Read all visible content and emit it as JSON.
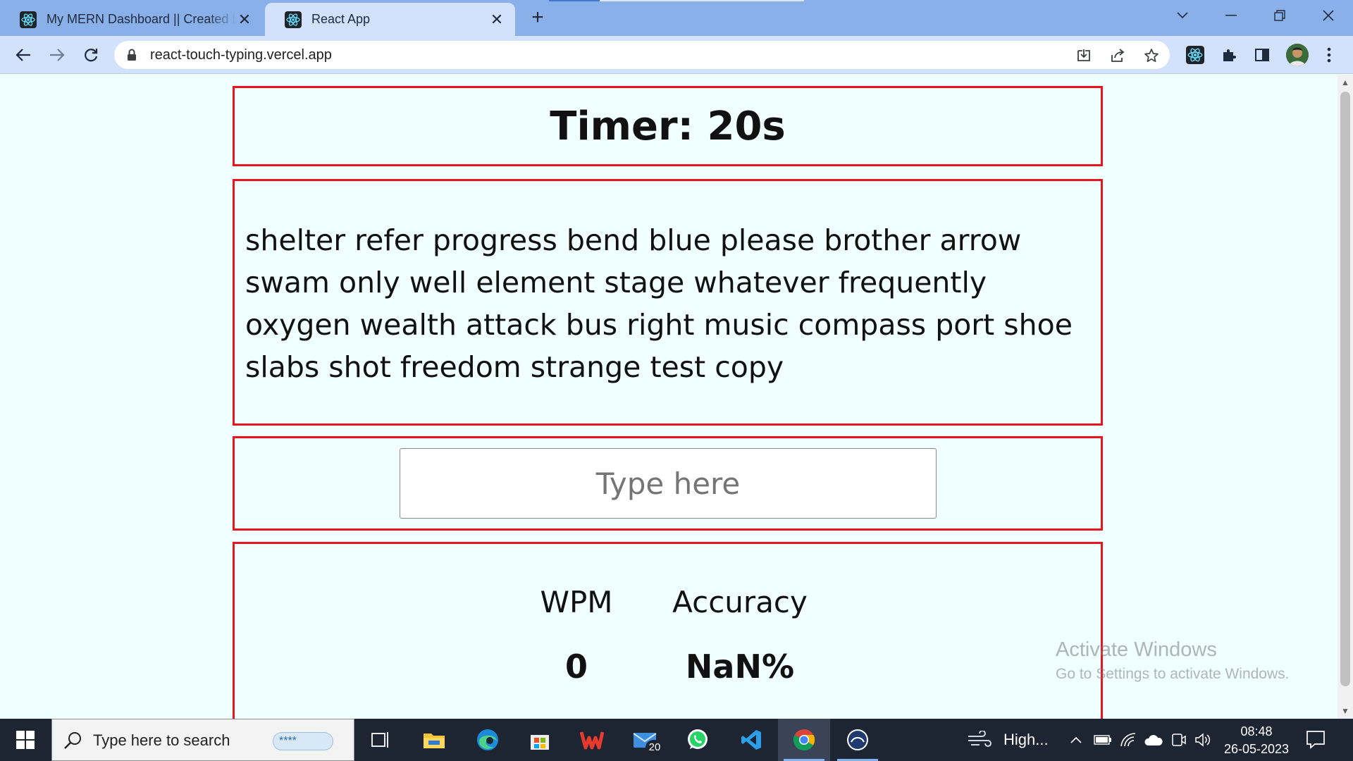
{
  "browser": {
    "tabs": [
      {
        "title": "My MERN Dashboard || Created by",
        "favicon": "react-icon",
        "active": false
      },
      {
        "title": "React App",
        "favicon": "react-icon",
        "active": true
      }
    ],
    "new_tab_symbol": "+",
    "close_symbol": "✕",
    "address": "react-touch-typing.vercel.app"
  },
  "page": {
    "timer_text": "Timer: 20s",
    "words": "shelter refer progress bend blue please brother arrow swam only well element stage whatever frequently oxygen wealth attack bus right music compass port shoe slabs shot freedom strange test copy",
    "input": {
      "placeholder": "Type here",
      "value": ""
    },
    "stats": {
      "wpm_label": "WPM",
      "wpm_value": "0",
      "accuracy_label": "Accuracy",
      "accuracy_value": "NaN%"
    }
  },
  "watermark": {
    "line1": "Activate Windows",
    "line2": "Go to Settings to activate Windows."
  },
  "taskbar": {
    "search_placeholder": "Type here to search",
    "password_chip": "****",
    "mail_badge": "20",
    "weather_text": "High...",
    "time": "08:48",
    "date": "26-05-2023"
  },
  "colors": {
    "tabbar": "#8ab0ea",
    "toolbar": "#d3e2fc",
    "page_bg": "#f0ffff",
    "box_border": "#e8141e",
    "taskbar": "#1d2532"
  }
}
